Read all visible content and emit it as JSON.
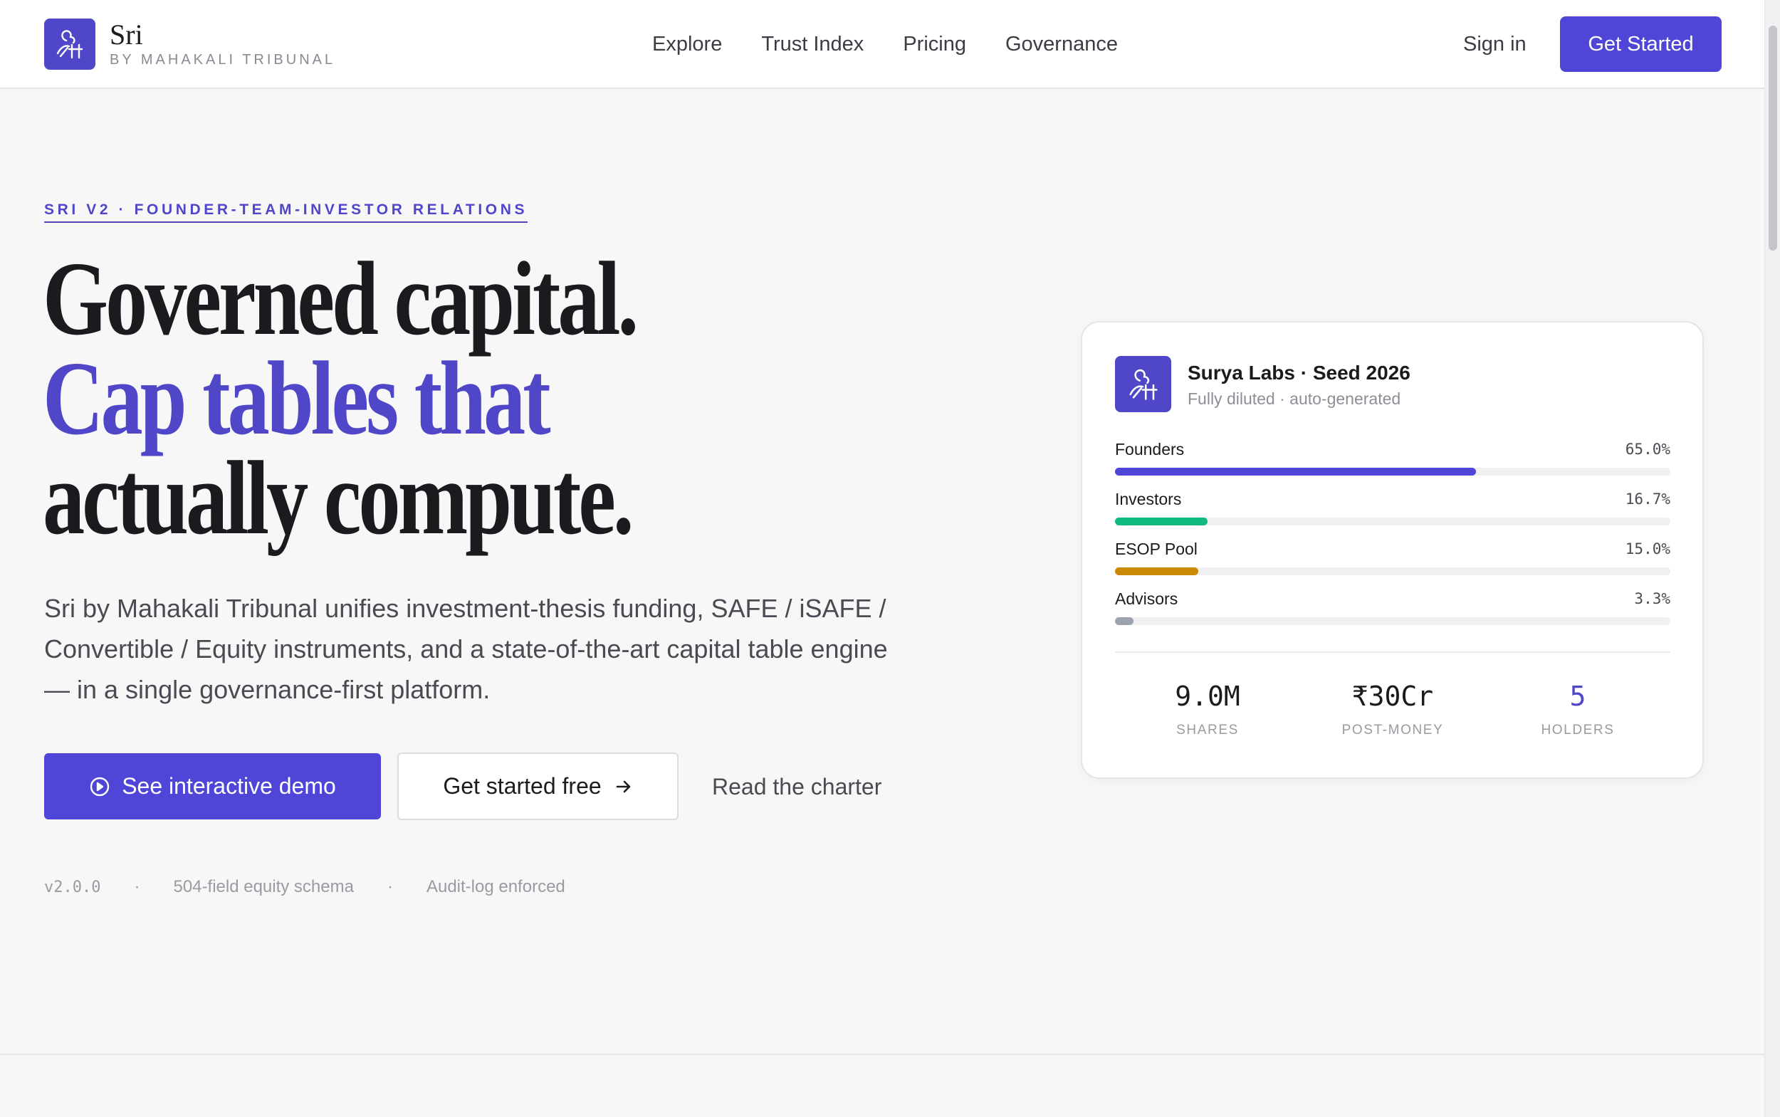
{
  "brand": {
    "name": "Sri",
    "tagline": "BY MAHAKALI TRIBUNAL",
    "color": "#4f46c8"
  },
  "nav": {
    "items": [
      {
        "label": "Explore"
      },
      {
        "label": "Trust Index"
      },
      {
        "label": "Pricing"
      },
      {
        "label": "Governance"
      }
    ],
    "sign_in": "Sign in",
    "cta": "Get Started"
  },
  "hero": {
    "eyebrow": "SRI V2 · FOUNDER-TEAM-INVESTOR RELATIONS",
    "headline_line1": "Governed capital.",
    "headline_line2": "Cap tables that",
    "headline_line3": "actually compute.",
    "lede": "Sri by Mahakali Tribunal unifies investment-thesis funding, SAFE / iSAFE / Convertible / Equity instruments, and a state-of-the-art capital table engine — in a single governance-first platform.",
    "demo_button": "See interactive demo",
    "free_button": "Get started free",
    "charter_link": "Read the charter",
    "meta": {
      "version": "v2.0.0",
      "sep": "·",
      "schema": "504-field equity schema",
      "audit": "Audit-log enforced"
    }
  },
  "card": {
    "title": "Surya Labs · Seed 2026",
    "subtitle": "Fully diluted · auto-generated",
    "rows": [
      {
        "label": "Founders",
        "value": "65.0%",
        "pct": 65.0,
        "color": "#4f46d8"
      },
      {
        "label": "Investors",
        "value": "16.7%",
        "pct": 16.7,
        "color": "#10b981"
      },
      {
        "label": "ESOP Pool",
        "value": "15.0%",
        "pct": 15.0,
        "color": "#ca8a04"
      },
      {
        "label": "Advisors",
        "value": "3.3%",
        "pct": 3.3,
        "color": "#9ca3af"
      }
    ],
    "stats": [
      {
        "value": "9.0M",
        "label": "SHARES"
      },
      {
        "value": "₹30Cr",
        "label": "POST-MONEY"
      },
      {
        "value": "5",
        "label": "HOLDERS"
      }
    ]
  },
  "icons": {
    "logo": "sri-monogram-icon",
    "demo": "play-circle-icon",
    "free": "arrow-right-icon"
  }
}
